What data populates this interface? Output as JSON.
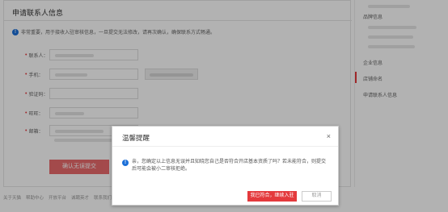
{
  "page": {
    "title": "申请联系人信息",
    "notice": "非常重要，用于接收入驻审核信息，一旦提交无法修改，请再次确认，确保联系方式畅通。",
    "form": {
      "fields": [
        {
          "label": "联系人："
        },
        {
          "label": "手机："
        },
        {
          "label": "验证码："
        },
        {
          "label": "旺旺："
        },
        {
          "label": "邮箱："
        }
      ]
    },
    "submit_label": "确认无误提交"
  },
  "sidebar": {
    "items": [
      {
        "label": "品牌信息"
      },
      {
        "label": "企业信息"
      },
      {
        "label": "店铺命名"
      },
      {
        "label": "申请联系人信息"
      }
    ]
  },
  "footer": {
    "links": [
      "关于天猫",
      "帮助中心",
      "开放平台",
      "诚聘英才",
      "联系我们"
    ]
  },
  "modal": {
    "title": "温馨提醒",
    "close_glyph": "×",
    "message": "亲，您确定以上信息无误并且知晓您自己是否符合开店基本资质了吗？若未能符合，则提交后可能会被小二审核拒绝。",
    "confirm_label": "我已符合，继续入驻",
    "cancel_label": "取消"
  },
  "colors": {
    "accent": "#e4393c",
    "info": "#1b6fd8"
  }
}
